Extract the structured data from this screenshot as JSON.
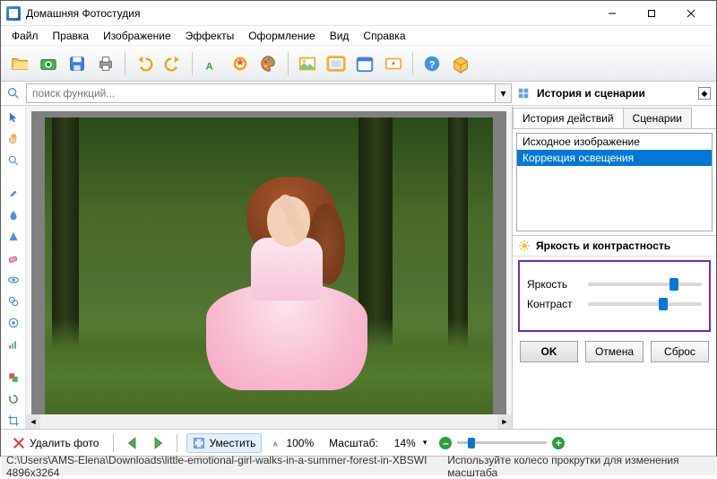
{
  "title": "Домашняя Фотостудия",
  "menu": [
    "Файл",
    "Правка",
    "Изображение",
    "Эффекты",
    "Оформление",
    "Вид",
    "Справка"
  ],
  "search": {
    "placeholder": "поиск функций..."
  },
  "right": {
    "panel_title": "История и сценарии",
    "tabs": [
      "История действий",
      "Сценарии"
    ],
    "active_tab": 0,
    "history": [
      {
        "label": "Исходное изображение",
        "selected": false
      },
      {
        "label": "Коррекция освещения",
        "selected": true
      }
    ],
    "section": "Яркость и контрастность",
    "sliders": {
      "brightness": {
        "label": "Яркость",
        "pos": 72
      },
      "contrast": {
        "label": "Контраст",
        "pos": 62
      }
    },
    "buttons": {
      "ok": "OK",
      "cancel": "Отмена",
      "reset": "Сброс"
    }
  },
  "bottom": {
    "delete": "Удалить фото",
    "fit": "Уместить",
    "hundred": "100%",
    "scale_label": "Масштаб:",
    "scale_value": "14%"
  },
  "status": {
    "path": "C:\\Users\\AMS-Elena\\Downloads\\little-emotional-girl-walks-in-a-summer-forest-in-XBSWI 4896x3264",
    "hint": "Используйте колесо прокрутки для изменения масштаба"
  }
}
